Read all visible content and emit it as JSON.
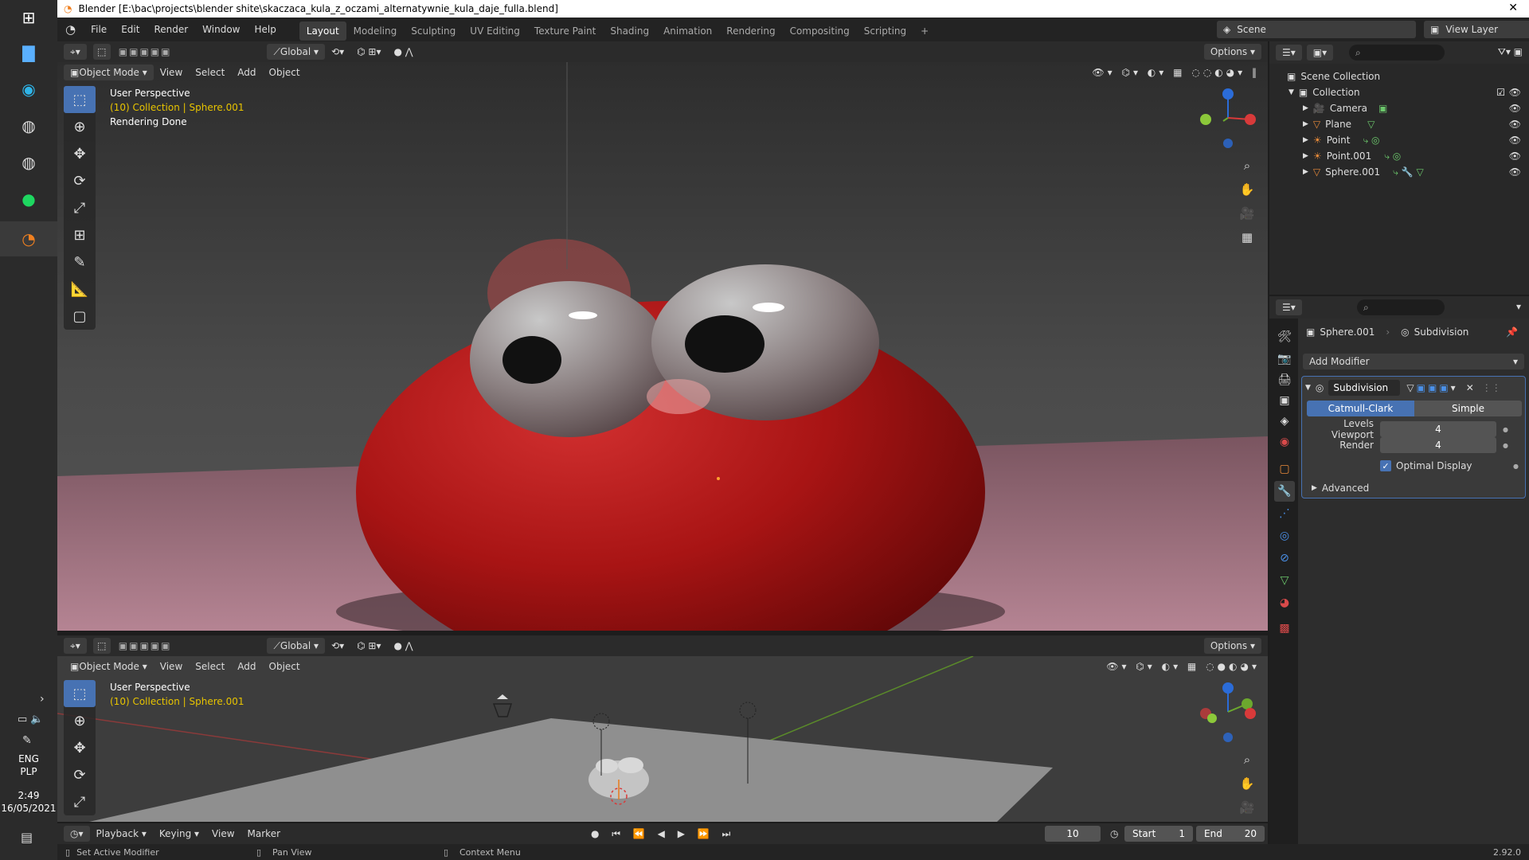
{
  "window": {
    "title": "Blender [E:\\bac\\projects\\blender shite\\skaczaca_kula_z_oczami_alternatywnie_kula_daje_fulla.blend]",
    "close": "✕"
  },
  "taskbar": {
    "lang": "ENG",
    "layout": "PLP",
    "time": "2:49",
    "date": "16/05/2021"
  },
  "menu": [
    "File",
    "Edit",
    "Render",
    "Window",
    "Help"
  ],
  "workspaces": [
    "Layout",
    "Modeling",
    "Sculpting",
    "UV Editing",
    "Texture Paint",
    "Shading",
    "Animation",
    "Rendering",
    "Compositing",
    "Scripting"
  ],
  "workspace_add": "+",
  "scene": {
    "name": "Scene",
    "view_layer": "View Layer"
  },
  "toolbar": {
    "transform": "Global",
    "options": "Options"
  },
  "viewport_header": {
    "mode": "Object Mode",
    "view": "View",
    "select": "Select",
    "add": "Add",
    "object": "Object"
  },
  "viewport_top": {
    "perspective": "User Perspective",
    "collection": "(10) Collection | Sphere.001",
    "status": "Rendering Done"
  },
  "viewport_bottom": {
    "perspective": "User Perspective",
    "collection": "(10) Collection | Sphere.001"
  },
  "outliner": {
    "root": "Scene Collection",
    "collection": "Collection",
    "items": [
      {
        "name": "Camera",
        "icon": "camera-icon"
      },
      {
        "name": "Plane",
        "icon": "mesh-icon"
      },
      {
        "name": "Point",
        "icon": "light-icon"
      },
      {
        "name": "Point.001",
        "icon": "light-icon"
      },
      {
        "name": "Sphere.001",
        "icon": "mesh-icon"
      }
    ]
  },
  "properties": {
    "object": "Sphere.001",
    "modifier_tab": "Subdivision",
    "add_modifier": "Add Modifier",
    "modifier_name": "Subdivision",
    "catmull": "Catmull-Clark",
    "simple": "Simple",
    "levels_label": "Levels Viewport",
    "levels_value": "4",
    "render_label": "Render",
    "render_value": "4",
    "optimal": "Optimal Display",
    "advanced": "Advanced"
  },
  "timeline": {
    "playback": "Playback",
    "keying": "Keying",
    "view": "View",
    "marker": "Marker",
    "frame": "10",
    "start_label": "Start",
    "start": "1",
    "end_label": "End",
    "end": "20"
  },
  "statusbar": {
    "left": "Set Active Modifier",
    "mid": "Pan View",
    "right": "Context Menu",
    "version": "2.92.0"
  },
  "colors": {
    "accent": "#4772b3",
    "sphere": "#b01515",
    "floor": "#b07888"
  }
}
